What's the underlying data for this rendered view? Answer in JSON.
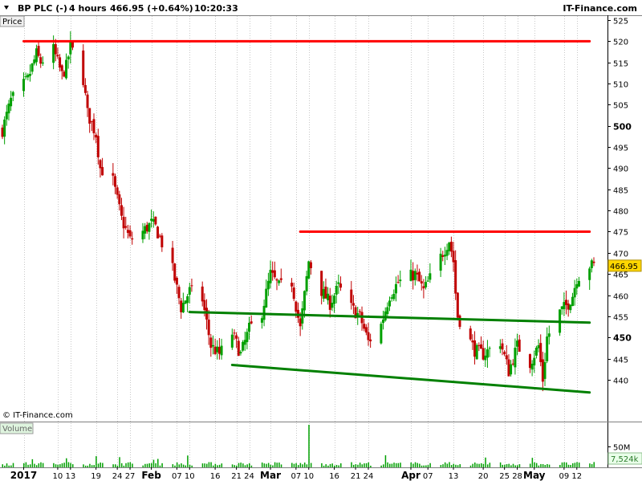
{
  "header": {
    "symbol": "BP PLC (-)",
    "interval": "4 hours",
    "last_quote": "466.95 (+0.64%)",
    "time": "10:20:33",
    "brand": "IT-Finance.com",
    "watermark": "© IT-Finance.com"
  },
  "colors": {
    "background": "#ffffff",
    "grid": "#c8c8c8",
    "up_candle": "#00a000",
    "down_candle": "#c00000",
    "resistance_line": "#ff0000",
    "support_line": "#008000",
    "volume_bar": "#00a000",
    "price_tag": "#ffd700",
    "volume_tag": "#e9ffe9"
  },
  "chart_data": [
    {
      "type": "candlestick",
      "title": "BP PLC (-)",
      "panel_label": "Price",
      "y_axis_side": "right",
      "ylim": [
        435,
        525
      ],
      "y_ticks": [
        440,
        445,
        450,
        455,
        460,
        465,
        470,
        475,
        480,
        485,
        490,
        495,
        500,
        505,
        510,
        515,
        520,
        525
      ],
      "y_tick_labels": [
        "440",
        "445",
        "450",
        "455",
        "460",
        "465",
        "470",
        "475",
        "480",
        "485",
        "490",
        "495",
        "500",
        "505",
        "510",
        "515",
        "520",
        "525"
      ],
      "y_bold_ticks": [
        450,
        500
      ],
      "last_price": 466.95,
      "last_price_label": "466.95",
      "grid": "vertical dotted",
      "x_time_range": [
        "2016-12-28",
        "2017-05-16"
      ],
      "x_tick_labels": [
        {
          "date": "2017-01-02",
          "label": "2017",
          "bold": true
        },
        {
          "date": "2017-01-10",
          "label": "10",
          "bold": false
        },
        {
          "date": "2017-01-13",
          "label": "13",
          "bold": false
        },
        {
          "date": "2017-01-19",
          "label": "19",
          "bold": false
        },
        {
          "date": "2017-01-24",
          "label": "24",
          "bold": false
        },
        {
          "date": "2017-01-27",
          "label": "27",
          "bold": false
        },
        {
          "date": "2017-02-01",
          "label": "Feb",
          "bold": true
        },
        {
          "date": "2017-02-07",
          "label": "07",
          "bold": false
        },
        {
          "date": "2017-02-10",
          "label": "10",
          "bold": false
        },
        {
          "date": "2017-02-16",
          "label": "16",
          "bold": false
        },
        {
          "date": "2017-02-21",
          "label": "21",
          "bold": false
        },
        {
          "date": "2017-02-24",
          "label": "24",
          "bold": false
        },
        {
          "date": "2017-03-01",
          "label": "Mar",
          "bold": true
        },
        {
          "date": "2017-03-07",
          "label": "07",
          "bold": false
        },
        {
          "date": "2017-03-10",
          "label": "10",
          "bold": false
        },
        {
          "date": "2017-03-16",
          "label": "16",
          "bold": false
        },
        {
          "date": "2017-03-21",
          "label": "21",
          "bold": false
        },
        {
          "date": "2017-03-24",
          "label": "24",
          "bold": false
        },
        {
          "date": "2017-04-03",
          "label": "Apr",
          "bold": true
        },
        {
          "date": "2017-04-07",
          "label": "07",
          "bold": false
        },
        {
          "date": "2017-04-13",
          "label": "13",
          "bold": false
        },
        {
          "date": "2017-04-20",
          "label": "20",
          "bold": false
        },
        {
          "date": "2017-04-25",
          "label": "25",
          "bold": false
        },
        {
          "date": "2017-04-28",
          "label": "28",
          "bold": false
        },
        {
          "date": "2017-05-02",
          "label": "May",
          "bold": true
        },
        {
          "date": "2017-05-09",
          "label": "09",
          "bold": false
        },
        {
          "date": "2017-05-12",
          "label": "12",
          "bold": false
        }
      ],
      "close_path": [
        [
          "2016-12-28",
          499
        ],
        [
          "2016-12-30",
          506
        ],
        [
          "2017-01-03",
          511
        ],
        [
          "2017-01-05",
          517
        ],
        [
          "2017-01-06",
          515
        ],
        [
          "2017-01-09",
          518
        ],
        [
          "2017-01-11",
          512
        ],
        [
          "2017-01-12",
          514
        ],
        [
          "2017-01-13",
          519
        ],
        [
          "2017-01-16",
          511
        ],
        [
          "2017-01-17",
          503
        ],
        [
          "2017-01-19",
          498
        ],
        [
          "2017-01-20",
          490
        ],
        [
          "2017-01-23",
          487
        ],
        [
          "2017-01-25",
          478
        ],
        [
          "2017-01-27",
          473
        ],
        [
          "2017-01-30",
          475
        ],
        [
          "2017-02-01",
          477
        ],
        [
          "2017-02-02",
          476
        ],
        [
          "2017-02-06",
          466
        ],
        [
          "2017-02-08",
          457
        ],
        [
          "2017-02-10",
          461
        ],
        [
          "2017-02-13",
          459
        ],
        [
          "2017-02-15",
          448
        ],
        [
          "2017-02-17",
          446
        ],
        [
          "2017-02-20",
          451
        ],
        [
          "2017-02-22",
          446
        ],
        [
          "2017-02-24",
          452
        ],
        [
          "2017-02-27",
          456
        ],
        [
          "2017-03-01",
          465
        ],
        [
          "2017-03-03",
          462
        ],
        [
          "2017-03-06",
          463
        ],
        [
          "2017-03-08",
          452
        ],
        [
          "2017-03-10",
          468
        ],
        [
          "2017-03-13",
          461
        ],
        [
          "2017-03-15",
          458
        ],
        [
          "2017-03-17",
          462
        ],
        [
          "2017-03-20",
          457
        ],
        [
          "2017-03-22",
          455
        ],
        [
          "2017-03-24",
          449
        ],
        [
          "2017-03-27",
          453
        ],
        [
          "2017-03-29",
          460
        ],
        [
          "2017-03-31",
          463
        ],
        [
          "2017-04-04",
          465
        ],
        [
          "2017-04-06",
          461
        ],
        [
          "2017-04-10",
          469
        ],
        [
          "2017-04-12",
          473
        ],
        [
          "2017-04-13",
          468
        ],
        [
          "2017-04-13",
          466
        ],
        [
          "2017-04-14",
          455
        ],
        [
          "2017-04-18",
          447
        ],
        [
          "2017-04-20",
          446
        ],
        [
          "2017-04-24",
          449
        ],
        [
          "2017-04-26",
          442
        ],
        [
          "2017-04-28",
          448
        ],
        [
          "2017-05-01",
          444
        ],
        [
          "2017-05-03",
          448
        ],
        [
          "2017-05-04",
          440
        ],
        [
          "2017-05-05",
          450
        ],
        [
          "2017-05-08",
          456
        ],
        [
          "2017-05-10",
          458
        ],
        [
          "2017-05-11",
          460
        ],
        [
          "2017-05-12",
          464
        ],
        [
          "2017-05-15",
          467
        ],
        [
          "2017-05-16",
          466.95
        ]
      ],
      "trend_lines": [
        {
          "kind": "resistance",
          "color": "#ff0000",
          "from": [
            "2017-01-02",
            520
          ],
          "to": [
            "2017-05-15",
            520
          ]
        },
        {
          "kind": "resistance",
          "color": "#ff0000",
          "from": [
            "2017-03-08",
            475
          ],
          "to": [
            "2017-05-15",
            475
          ]
        },
        {
          "kind": "support",
          "color": "#008000",
          "from": [
            "2017-02-10",
            456
          ],
          "to": [
            "2017-05-15",
            453.5
          ]
        },
        {
          "kind": "support",
          "color": "#008000",
          "from": [
            "2017-02-20",
            443.5
          ],
          "to": [
            "2017-05-15",
            437
          ]
        }
      ]
    },
    {
      "type": "bar",
      "title": "Volume",
      "panel_label": "Volume",
      "y_ticks": [
        50000000
      ],
      "y_tick_labels": [
        "50M"
      ],
      "ylim": [
        0,
        100000000
      ],
      "last_value_label": "7,524k",
      "peak": {
        "date": "2017-03-10",
        "value": 112000000
      },
      "x_time_range": [
        "2016-12-28",
        "2017-05-16"
      ]
    }
  ]
}
